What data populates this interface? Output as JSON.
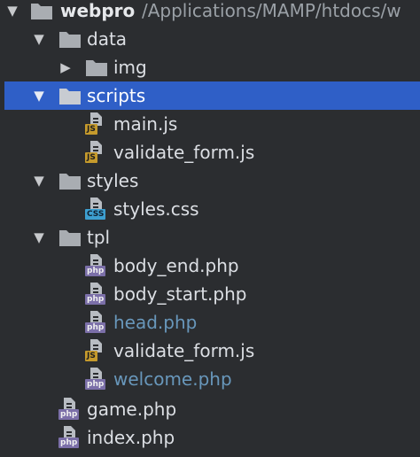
{
  "colors": {
    "background": "#2b2d30",
    "selection": "#2f5fc7",
    "folder": "#a9adb2",
    "modified_text": "#6897bb",
    "js_badge": "#c59a2c",
    "php_badge": "#7b6fa8",
    "css_badge": "#3d9fd0"
  },
  "tree": {
    "root": {
      "name": "webpro",
      "path": "/Applications/MAMP/htdocs/w",
      "icon": "folder-icon",
      "expanded": true
    },
    "data": {
      "name": "data",
      "icon": "folder-icon",
      "expanded": true
    },
    "img": {
      "name": "img",
      "icon": "folder-icon",
      "expanded": false
    },
    "scripts": {
      "name": "scripts",
      "icon": "folder-icon",
      "expanded": true,
      "selected": true
    },
    "main_js": {
      "name": "main.js",
      "badge": "JS",
      "icon": "js-file-icon"
    },
    "validate_form_js_1": {
      "name": "validate_form.js",
      "badge": "JS",
      "icon": "js-file-icon"
    },
    "styles": {
      "name": "styles",
      "icon": "folder-icon",
      "expanded": true
    },
    "styles_css": {
      "name": "styles.css",
      "badge": "CSS",
      "icon": "css-file-icon"
    },
    "tpl": {
      "name": "tpl",
      "icon": "folder-icon",
      "expanded": true
    },
    "body_end_php": {
      "name": "body_end.php",
      "badge": "php",
      "icon": "php-file-icon"
    },
    "body_start_php": {
      "name": "body_start.php",
      "badge": "php",
      "icon": "php-file-icon"
    },
    "head_php": {
      "name": "head.php",
      "badge": "php",
      "icon": "php-file-icon",
      "modified": true
    },
    "validate_form_js_2": {
      "name": "validate_form.js",
      "badge": "JS",
      "icon": "js-file-icon"
    },
    "welcome_php": {
      "name": "welcome.php",
      "badge": "php",
      "icon": "php-file-icon",
      "modified": true
    },
    "game_php": {
      "name": "game.php",
      "badge": "php",
      "icon": "php-file-icon"
    },
    "index_php": {
      "name": "index.php",
      "badge": "php",
      "icon": "php-file-icon"
    }
  }
}
